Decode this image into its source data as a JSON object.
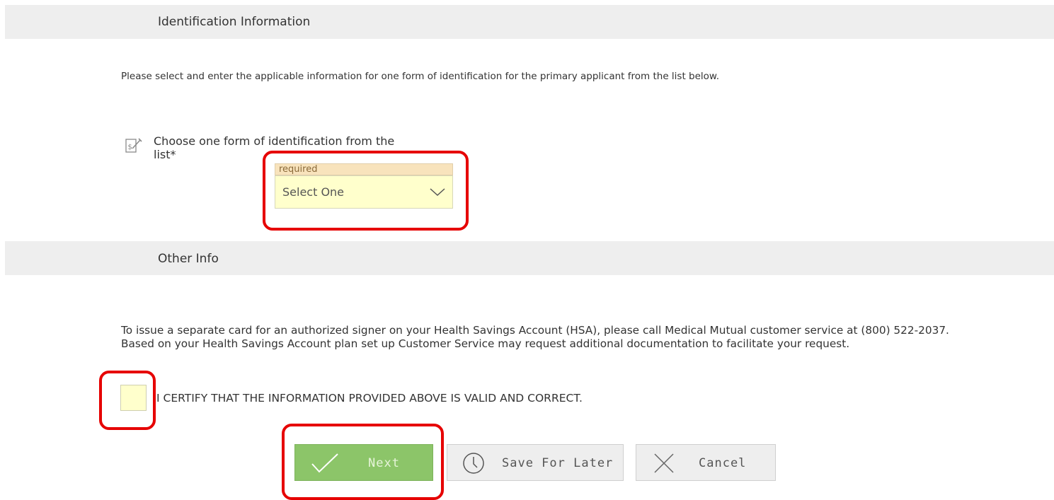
{
  "sections": {
    "identification": {
      "title": "Identification Information"
    },
    "other": {
      "title": "Other Info"
    }
  },
  "intro_text": "Please select and enter the applicable information for one form of identification for the primary applicant from the list below.",
  "id_field": {
    "label": "Choose one form of identification from the list*",
    "icon": "form-edit-icon",
    "required_tag": "required",
    "selected_value": "Select One"
  },
  "hsa_info": "To issue a separate card for an authorized signer on your Health Savings Account (HSA), please call Medical Mutual customer service at (800) 522-2037. Based on your Health Savings Account plan set up Customer Service may request additional documentation to facilitate your request.",
  "certify": {
    "checked": false,
    "label": "I CERTIFY THAT THE INFORMATION PROVIDED ABOVE IS VALID AND CORRECT."
  },
  "buttons": {
    "next": {
      "label": "Next",
      "icon": "checkmark-icon"
    },
    "save": {
      "label": "Save For Later",
      "icon": "clock-icon"
    },
    "cancel": {
      "label": "Cancel",
      "icon": "close-icon"
    }
  },
  "colors": {
    "section_bar": "#eeeeee",
    "required_tag_bg": "#f8e3bc",
    "field_bg": "#ffffcc",
    "next_button": "#8cc569",
    "highlight": "#e60000"
  }
}
